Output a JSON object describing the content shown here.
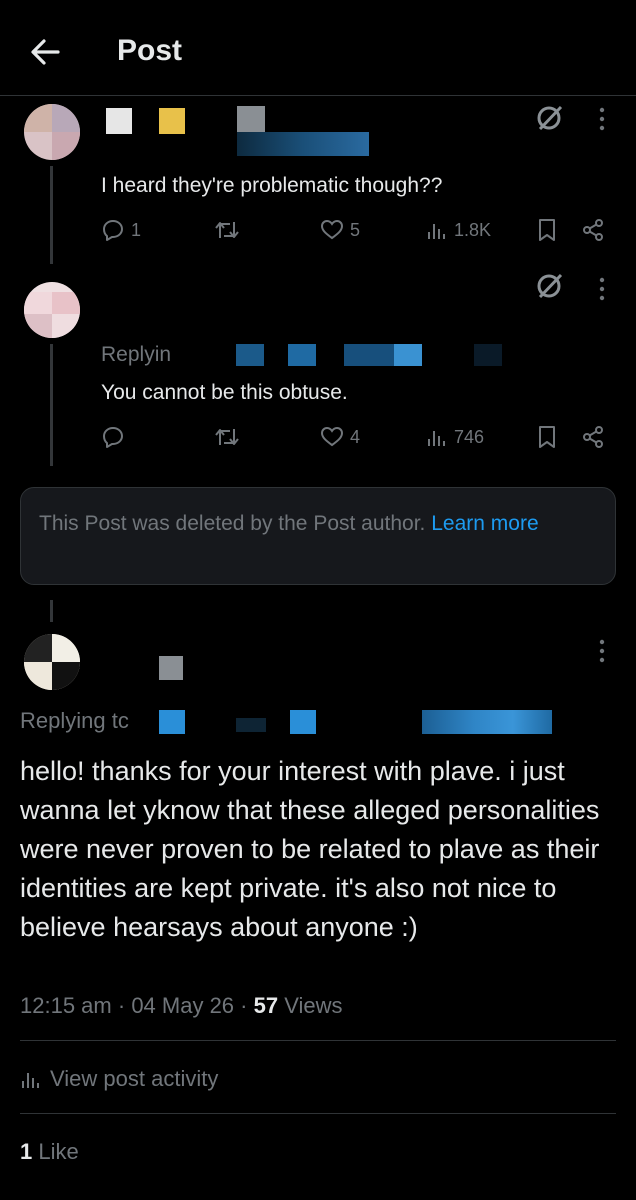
{
  "header": {
    "title": "Post"
  },
  "reply1": {
    "text": "I heard they're problematic though??",
    "replies": "1",
    "likes": "5",
    "views": "1.8K"
  },
  "reply2": {
    "replying_label": "Replyin",
    "text": "You cannot be this obtuse.",
    "likes": "4",
    "views": "746"
  },
  "deleted_notice": {
    "text": "This Post was deleted by the Post author.",
    "link": "Learn more"
  },
  "main_post": {
    "replying_label": "Replying tc",
    "text": "hello! thanks for your interest with plave. i just wanna let yknow that these alleged personalities were never proven to be related to plave as their identities are kept private. it's also not nice to believe hearsays about anyone :)",
    "time": "12:15 am",
    "date": "04 May 26",
    "views_count": "57",
    "views_label": "Views",
    "activity_label": "View post activity",
    "likes_count": "1",
    "likes_label": "Like"
  },
  "colors": {
    "accent": "#1d9bf0",
    "muted": "#71767b",
    "background": "#000000"
  }
}
